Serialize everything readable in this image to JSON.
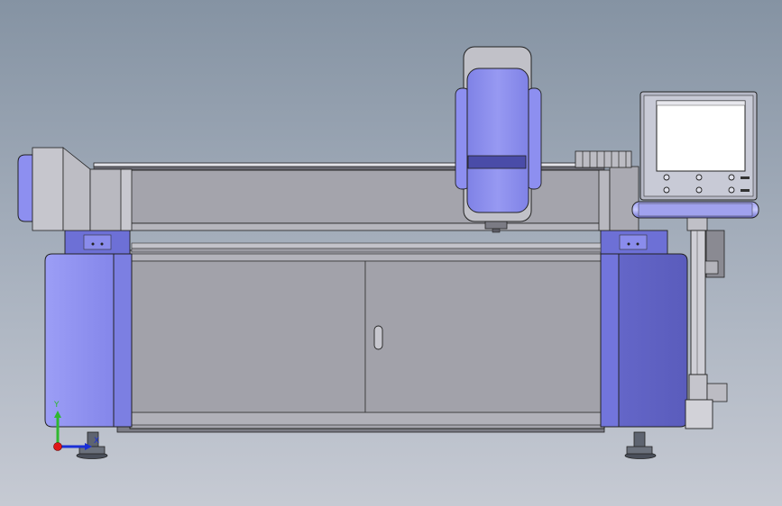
{
  "view": {
    "title": "",
    "colors": {
      "background_top": "#8593a3",
      "background_bottom": "#c6cad3",
      "cabinet_blue": "#8d8ff0",
      "cabinet_blue_dark": "#5c5fc0",
      "frame_gray": "#a6a6ad",
      "panel_gray": "#a3a3ab",
      "screen_white": "#ffffff"
    }
  },
  "triad": {
    "y_label": "Y",
    "x_label": "X",
    "y_color": "#2fb830",
    "x_color": "#1a2fd6",
    "origin_color": "#e01818"
  },
  "control_panel": {
    "screen": "display",
    "buttons": [
      {
        "name": "button-top-left",
        "label": ""
      },
      {
        "name": "button-top-middle",
        "label": ""
      },
      {
        "name": "button-top-right",
        "label": ""
      },
      {
        "name": "button-bottom-left",
        "label": ""
      },
      {
        "name": "button-bottom-middle",
        "label": ""
      },
      {
        "name": "button-bottom-right",
        "label": ""
      }
    ]
  },
  "parts": {
    "left_cabinet": "cabinet",
    "right_cabinet": "cabinet",
    "cutting_head": "tool-carriage",
    "cable_chain": "drag-chain",
    "door_handle": "handle"
  }
}
